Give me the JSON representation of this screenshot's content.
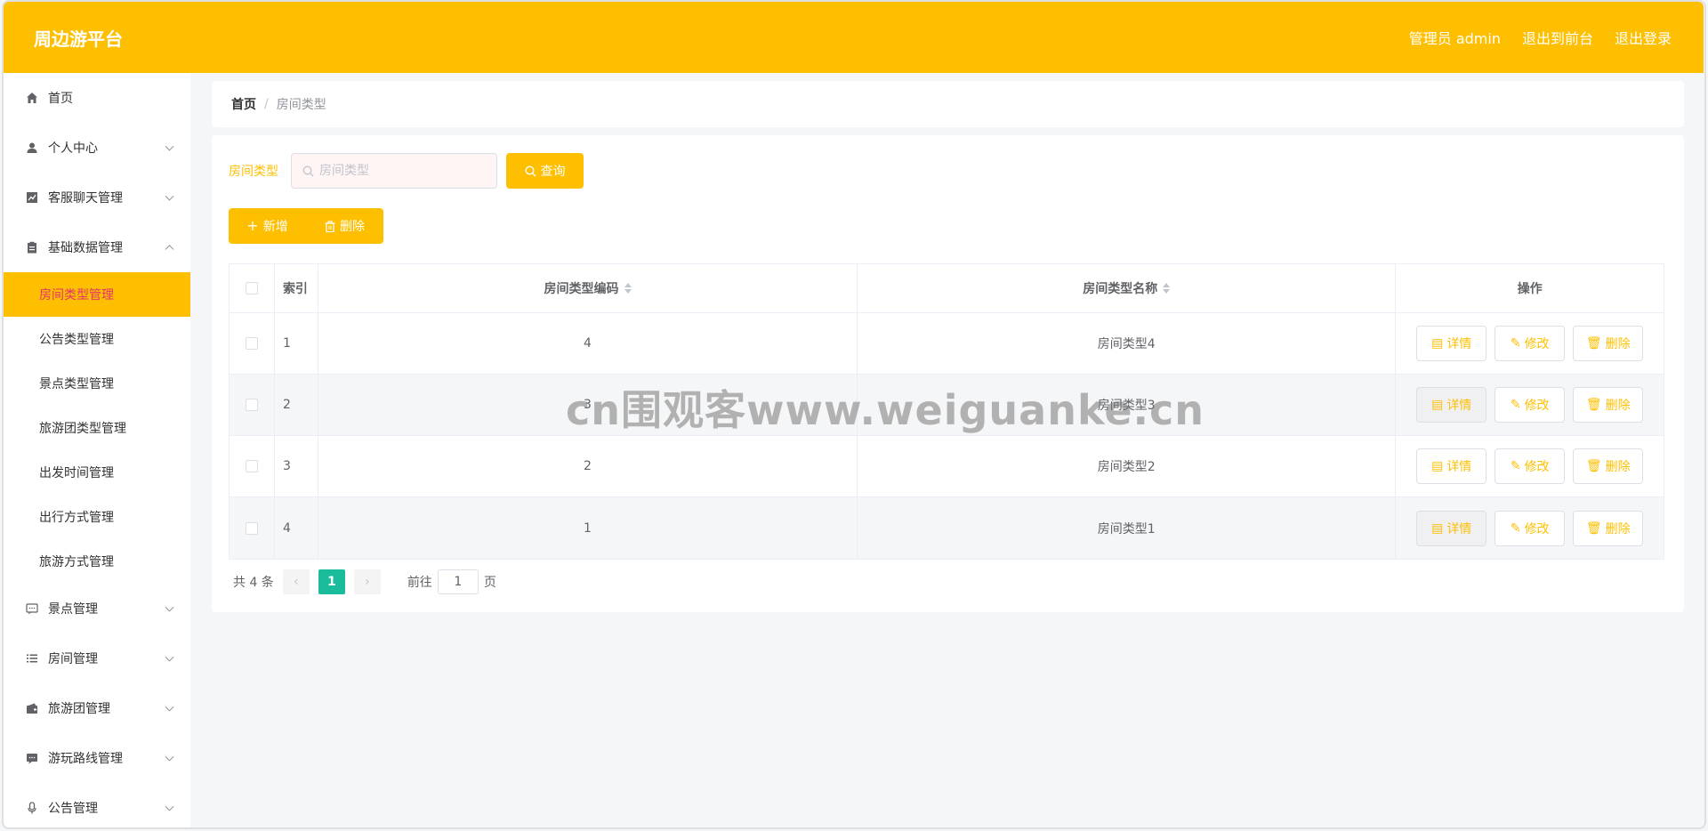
{
  "header": {
    "brand": "周边游平台",
    "admin_label": "管理员 admin",
    "to_front": "退出到前台",
    "logout": "退出登录"
  },
  "sidebar": {
    "items": [
      {
        "label": "首页",
        "icon": "home-icon",
        "expandable": false
      },
      {
        "label": "个人中心",
        "icon": "user-icon",
        "expandable": true
      },
      {
        "label": "客服聊天管理",
        "icon": "chart-icon",
        "expandable": true
      },
      {
        "label": "基础数据管理",
        "icon": "clipboard-icon",
        "expandable": true,
        "expanded": true
      },
      {
        "label": "景点管理",
        "icon": "chat-icon",
        "expandable": true
      },
      {
        "label": "房间管理",
        "icon": "list-icon",
        "expandable": true
      },
      {
        "label": "旅游团管理",
        "icon": "wallet-icon",
        "expandable": true
      },
      {
        "label": "游玩路线管理",
        "icon": "message-icon",
        "expandable": true
      },
      {
        "label": "公告管理",
        "icon": "mic-icon",
        "expandable": true
      }
    ],
    "sub_items": [
      "房间类型管理",
      "公告类型管理",
      "景点类型管理",
      "旅游团类型管理",
      "出发时间管理",
      "出行方式管理",
      "旅游方式管理"
    ],
    "active_sub": "房间类型管理"
  },
  "breadcrumb": {
    "home": "首页",
    "separator": "/",
    "current": "房间类型"
  },
  "search": {
    "label": "房间类型",
    "placeholder": "房间类型",
    "query_button": "查询"
  },
  "actions": {
    "add": "新增",
    "delete": "删除"
  },
  "table": {
    "columns": [
      "索引",
      "房间类型编码",
      "房间类型名称",
      "操作"
    ],
    "rows": [
      {
        "index": "1",
        "code": "4",
        "name": "房间类型4"
      },
      {
        "index": "2",
        "code": "3",
        "name": "房间类型3"
      },
      {
        "index": "3",
        "code": "2",
        "name": "房间类型2"
      },
      {
        "index": "4",
        "code": "1",
        "name": "房间类型1"
      }
    ],
    "op_labels": {
      "detail": "详情",
      "edit": "修改",
      "delete": "删除"
    }
  },
  "pagination": {
    "total": "共 4 条",
    "current_page": "1",
    "goto_label": "前往",
    "goto_value": "1",
    "page_suffix": "页"
  },
  "watermark": "cn围观客www.weiguanke.cn",
  "colors": {
    "accent": "#fdbf00",
    "active_text": "#e5336f",
    "pager_active": "#1abc9c"
  }
}
